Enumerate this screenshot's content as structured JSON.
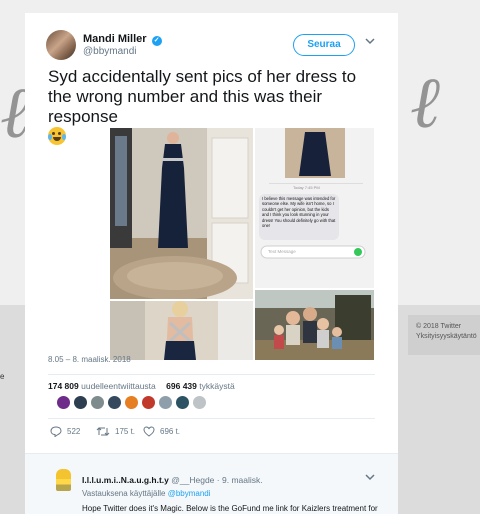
{
  "background": {
    "footer_copyright": "© 2018 Twitter",
    "footer_privacy": "Yksityisyyskäytäntö",
    "edge_text": "e"
  },
  "tweet": {
    "author_name": "Mandi Miller",
    "author_handle": "@bbymandi",
    "follow_label": "Seuraa",
    "text": "Syd accidentally sent pics of her dress to the wrong number and this was their response",
    "emoji": "face-with-tears-of-joy",
    "timestamp": "8.05 – 8. maalisk. 2018",
    "retweets_count": "174 809",
    "retweets_label": "uudelleentwiittausta",
    "likes_count": "696 439",
    "likes_label": "tykkäystä",
    "reply_count": "522",
    "retweet_action_count": "175 t.",
    "like_action_count": "696 t."
  },
  "screenshot_message": {
    "time": "Today 7:45 PM",
    "body": "I believe this message was intended for someone else. My wife isn't home, so I couldn't get her opinion, but the kids and I think you look stunning in your dress! You should definitely go with that one!",
    "input_placeholder": "Text Message"
  },
  "reply": {
    "name": "I.l.l.u.m.i..N.a.u.g.h.t.y",
    "handle": "@__Hegde",
    "date": "9. maalisk.",
    "replying_prefix": "Vastauksena käyttäjälle",
    "replying_to": "@bbymandi",
    "text": "Hope Twitter does it's Magic. Below is the GoFund me link for Kaizlers treatment for Leukaemia."
  },
  "colors": {
    "accent": "#1da1f2",
    "secondary_text": "#657786",
    "liker_avatars": [
      "#6e2b8a",
      "#2c3e50",
      "#7f8c8d",
      "#34495e",
      "#e67e22",
      "#c0392b",
      "#8e9eab",
      "#2c5364",
      "#bdc3c7"
    ]
  }
}
